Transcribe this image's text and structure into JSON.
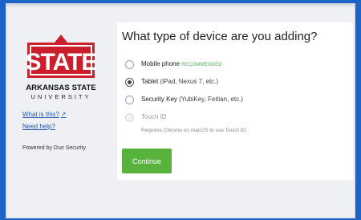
{
  "sidebar": {
    "logo_name": "ARKANSAS STATE",
    "logo_sub": "UNIVERSITY",
    "logo_wordmark": "STATE",
    "what_is_this": "What is this?",
    "need_help": "Need help?",
    "powered_by": "Powered by Duo Security"
  },
  "main": {
    "title": "What type of device are you adding?",
    "options": [
      {
        "label": "Mobile phone",
        "detail": "",
        "badge": "RECOMMENDED",
        "selected": false,
        "disabled": false
      },
      {
        "label": "Tablet",
        "detail": "(iPad, Nexus 7, etc.)",
        "badge": "",
        "selected": true,
        "disabled": false
      },
      {
        "label": "Security Key",
        "detail": "(YubiKey, Feitian, etc.)",
        "badge": "",
        "selected": false,
        "disabled": false
      },
      {
        "label": "Touch ID",
        "detail": "",
        "badge": "",
        "selected": false,
        "disabled": true
      }
    ],
    "touch_id_note": "Requires Chrome on macOS to use Touch ID.",
    "continue_label": "Continue"
  },
  "colors": {
    "background": "#1e63c8",
    "accent_green": "#58b33d",
    "brand_red": "#cc1f2d",
    "link_blue": "#2156b0"
  }
}
